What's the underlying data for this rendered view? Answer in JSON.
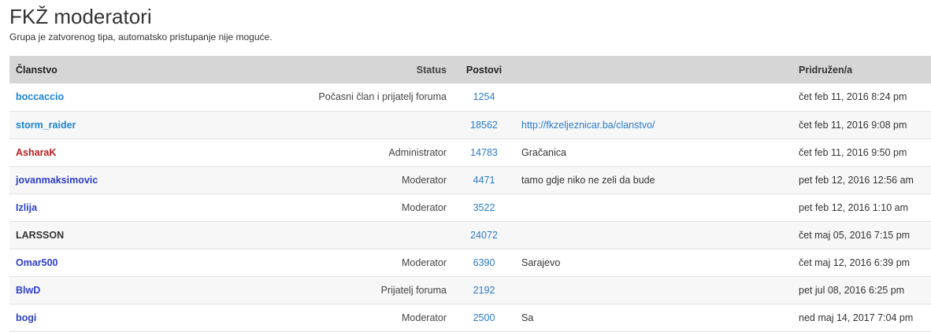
{
  "page": {
    "title": "FKŽ moderatori",
    "subtitle": "Grupa je zatvorenog tipa, automatsko pristupanje nije moguće."
  },
  "table": {
    "headers": {
      "member": "Članstvo",
      "status": "Status",
      "posts": "Postovi",
      "info": "",
      "joined": "Pridružen/a"
    },
    "rows": [
      {
        "name": "boccaccio",
        "name_color": "#1a84d4",
        "bold": true,
        "status": "Počasni član i prijatelj foruma",
        "posts": "1254",
        "info": "",
        "info_is_link": false,
        "joined": "čet feb 11, 2016 8:24 pm"
      },
      {
        "name": "storm_raider",
        "name_color": "#1a84d4",
        "bold": true,
        "status": "",
        "posts": "18562",
        "info": "http://fkzeljeznicar.ba/clanstvo/",
        "info_is_link": true,
        "joined": "čet feb 11, 2016 9:08 pm"
      },
      {
        "name": "AsharaK",
        "name_color": "#b81e1e",
        "bold": false,
        "status": "Administrator",
        "posts": "14783",
        "info": "Gračanica",
        "info_is_link": false,
        "joined": "čet feb 11, 2016 9:50 pm"
      },
      {
        "name": "jovanmaksimovic",
        "name_color": "#2c3fc9",
        "bold": true,
        "status": "Moderator",
        "posts": "4471",
        "info": "tamo gdje niko ne zeli da bude",
        "info_is_link": false,
        "joined": "pet feb 12, 2016 12:56 am"
      },
      {
        "name": "Izlija",
        "name_color": "#2c3fc9",
        "bold": true,
        "status": "Moderator",
        "posts": "3522",
        "info": "",
        "info_is_link": false,
        "joined": "pet feb 12, 2016 1:10 am"
      },
      {
        "name": "LARSSON",
        "name_color": "#333333",
        "bold": false,
        "status": "",
        "posts": "24072",
        "info": "",
        "info_is_link": false,
        "joined": "čet maj 05, 2016 7:15 pm"
      },
      {
        "name": "Omar500",
        "name_color": "#2c3fc9",
        "bold": true,
        "status": "Moderator",
        "posts": "6390",
        "info": "Sarajevo",
        "info_is_link": false,
        "joined": "čet maj 12, 2016 6:39 pm"
      },
      {
        "name": "BlwD",
        "name_color": "#2c3fc9",
        "bold": true,
        "status": "Prijatelj foruma",
        "posts": "2192",
        "info": "",
        "info_is_link": false,
        "joined": "pet jul 08, 2016 6:25 pm"
      },
      {
        "name": "bogi",
        "name_color": "#2c3fc9",
        "bold": true,
        "status": "Moderator",
        "posts": "2500",
        "info": "Sa",
        "info_is_link": false,
        "joined": "ned maj 14, 2017 7:04 pm"
      }
    ]
  }
}
